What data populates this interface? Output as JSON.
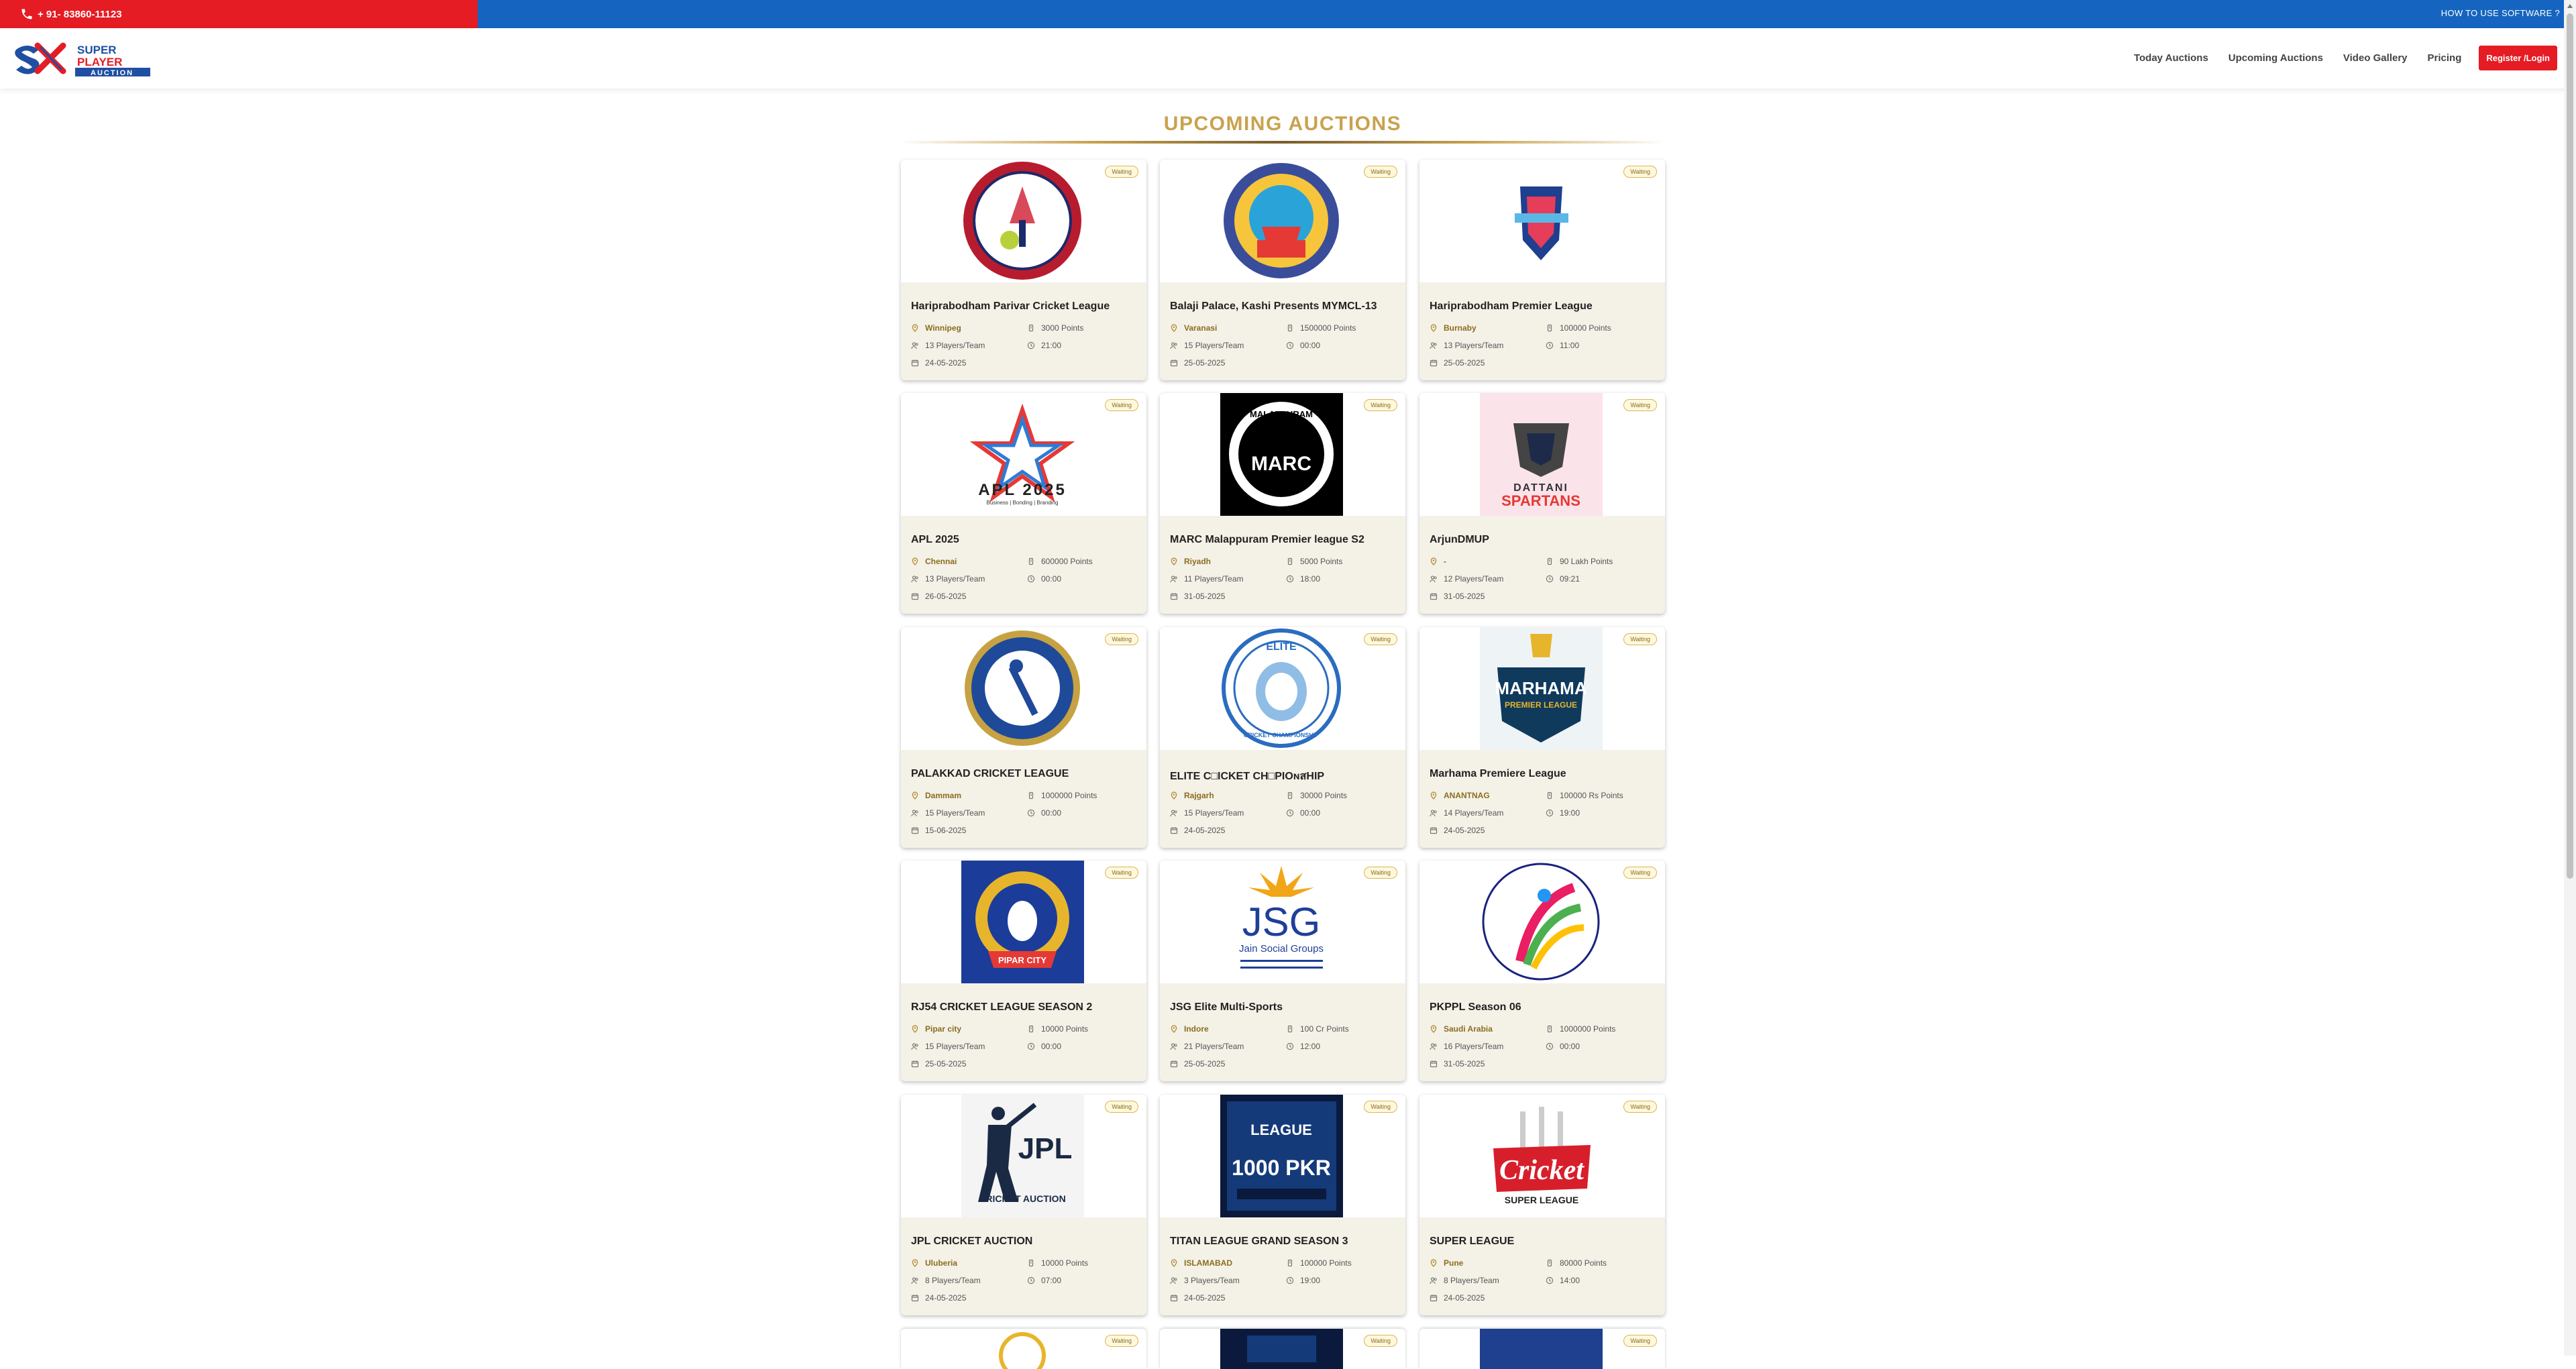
{
  "topbar": {
    "phone": "+ 91- 83860-11123",
    "howto": "HOW TO USE SOFTWARE ?"
  },
  "brand": {
    "line1": "SUPER",
    "line2": "PLAYER",
    "line3": "AUCTION",
    "mark": "SPA"
  },
  "nav": {
    "items": [
      "Today Auctions",
      "Upcoming Auctions",
      "Video Gallery",
      "Pricing"
    ],
    "register": "Register /Login"
  },
  "heading": "UPCOMING AUCTIONS",
  "colors": {
    "red": "#e51c23",
    "blue": "#1565c0",
    "gold": "#c9a24f",
    "card_bg": "#f4f1e7"
  },
  "cards": [
    {
      "status": "Waiting",
      "title": "Hariprabodham Parivar Cricket League",
      "location": "Winnipeg",
      "points": "3000 Points",
      "players": "13 Players/Team",
      "time": "21:00",
      "date": "24-05-2025",
      "logo": "hpcl-round-logo"
    },
    {
      "status": "Waiting",
      "title": "Balaji Palace, Kashi Presents MYMCL-13",
      "location": "Varanasi",
      "points": "1500000 Points",
      "players": "15 Players/Team",
      "time": "00:00",
      "date": "25-05-2025",
      "logo": "yuva-manch-logo"
    },
    {
      "status": "Waiting",
      "title": "Hariprabodham Premier League",
      "location": "Burnaby",
      "points": "100000 Points",
      "players": "13 Players/Team",
      "time": "11:00",
      "date": "25-05-2025",
      "logo": "vancouver-logo"
    },
    {
      "status": "Waiting",
      "title": "APL 2025",
      "location": "Chennai",
      "points": "600000 Points",
      "players": "13 Players/Team",
      "time": "00:00",
      "date": "26-05-2025",
      "logo": "apl-star-logo",
      "logo_text": "APL 2025",
      "logo_sub": "Business | Bonding | Branding"
    },
    {
      "status": "Waiting",
      "title": "MARC Malappuram Premier league S2",
      "location": "Riyadh",
      "points": "5000 Points",
      "players": "11 Players/Team",
      "time": "18:00",
      "date": "31-05-2025",
      "logo": "marc-logo",
      "logo_text": "MARC",
      "logo_top": "MALAPPURAM"
    },
    {
      "status": "Waiting",
      "title": "ArjunDMUP",
      "location": "-",
      "points": "90 Lakh Points",
      "players": "12 Players/Team",
      "time": "09:21",
      "date": "31-05-2025",
      "logo": "spartans-logo",
      "logo_text": "DATTANI",
      "logo_sub": "SPARTANS"
    },
    {
      "status": "Waiting",
      "title": "PALAKKAD CRICKET LEAGUE",
      "location": "Dammam",
      "points": "1000000 Points",
      "players": "15 Players/Team",
      "time": "00:00",
      "date": "15-06-2025",
      "logo": "palakkad-logo"
    },
    {
      "status": "Waiting",
      "title": "ELITE C□ICKET CH□PΙOɴสHIP",
      "location": "Rajgarh",
      "points": "30000 Points",
      "players": "15 Players/Team",
      "time": "00:00",
      "date": "24-05-2025",
      "logo": "elite-tiger-logo",
      "logo_text": "ELITE",
      "logo_sub": "CRICKET CHAMPIONSHIP"
    },
    {
      "status": "Waiting",
      "title": "Marhama Premiere League",
      "location": "ANANTNAG",
      "points": "100000 Rs Points",
      "players": "14 Players/Team",
      "time": "19:00",
      "date": "24-05-2025",
      "logo": "marhama-logo",
      "logo_text": "MARHAMA",
      "logo_sub": "PREMIER LEAGUE"
    },
    {
      "status": "Waiting",
      "title": "RJ54 CRICKET LEAGUE SEASON 2",
      "location": "Pipar city",
      "points": "10000 Points",
      "players": "15 Players/Team",
      "time": "00:00",
      "date": "25-05-2025",
      "logo": "rj54-logo",
      "logo_text": "PIPAR CITY"
    },
    {
      "status": "Waiting",
      "title": "JSG Elite Multi-Sports",
      "location": "Indore",
      "points": "100 Cr Points",
      "players": "21 Players/Team",
      "time": "12:00",
      "date": "25-05-2025",
      "logo": "jsg-logo",
      "logo_text": "JSG",
      "logo_sub": "Jain Social Groups"
    },
    {
      "status": "Waiting",
      "title": "PKPPL Season 06",
      "location": "Saudi Arabia",
      "points": "1000000 Points",
      "players": "16 Players/Team",
      "time": "00:00",
      "date": "31-05-2025",
      "logo": "pkppl-logo"
    },
    {
      "status": "Waiting",
      "title": "JPL CRICKET AUCTION",
      "location": "Uluberia",
      "points": "10000 Points",
      "players": "8 Players/Team",
      "time": "07:00",
      "date": "24-05-2025",
      "logo": "jpl-logo",
      "logo_text": "JPL",
      "logo_sub": "CRICKET AUCTION"
    },
    {
      "status": "Waiting",
      "title": "TITAN LEAGUE GRAND SEASON 3",
      "location": "ISLAMABAD",
      "points": "100000 Points",
      "players": "3 Players/Team",
      "time": "19:00",
      "date": "24-05-2025",
      "logo": "titan-poster-logo",
      "logo_text": "LEAGUE",
      "logo_sub": "1000 PKR"
    },
    {
      "status": "Waiting",
      "title": "SUPER LEAGUE",
      "location": "Pune",
      "points": "80000 Points",
      "players": "8 Players/Team",
      "time": "14:00",
      "date": "24-05-2025",
      "logo": "cricket-super-league-logo",
      "logo_text": "Cricket",
      "logo_sub": "SUPER LEAGUE"
    }
  ],
  "partial_cards": [
    {
      "status": "Waiting"
    },
    {
      "status": "Waiting"
    },
    {
      "status": "Waiting"
    }
  ]
}
